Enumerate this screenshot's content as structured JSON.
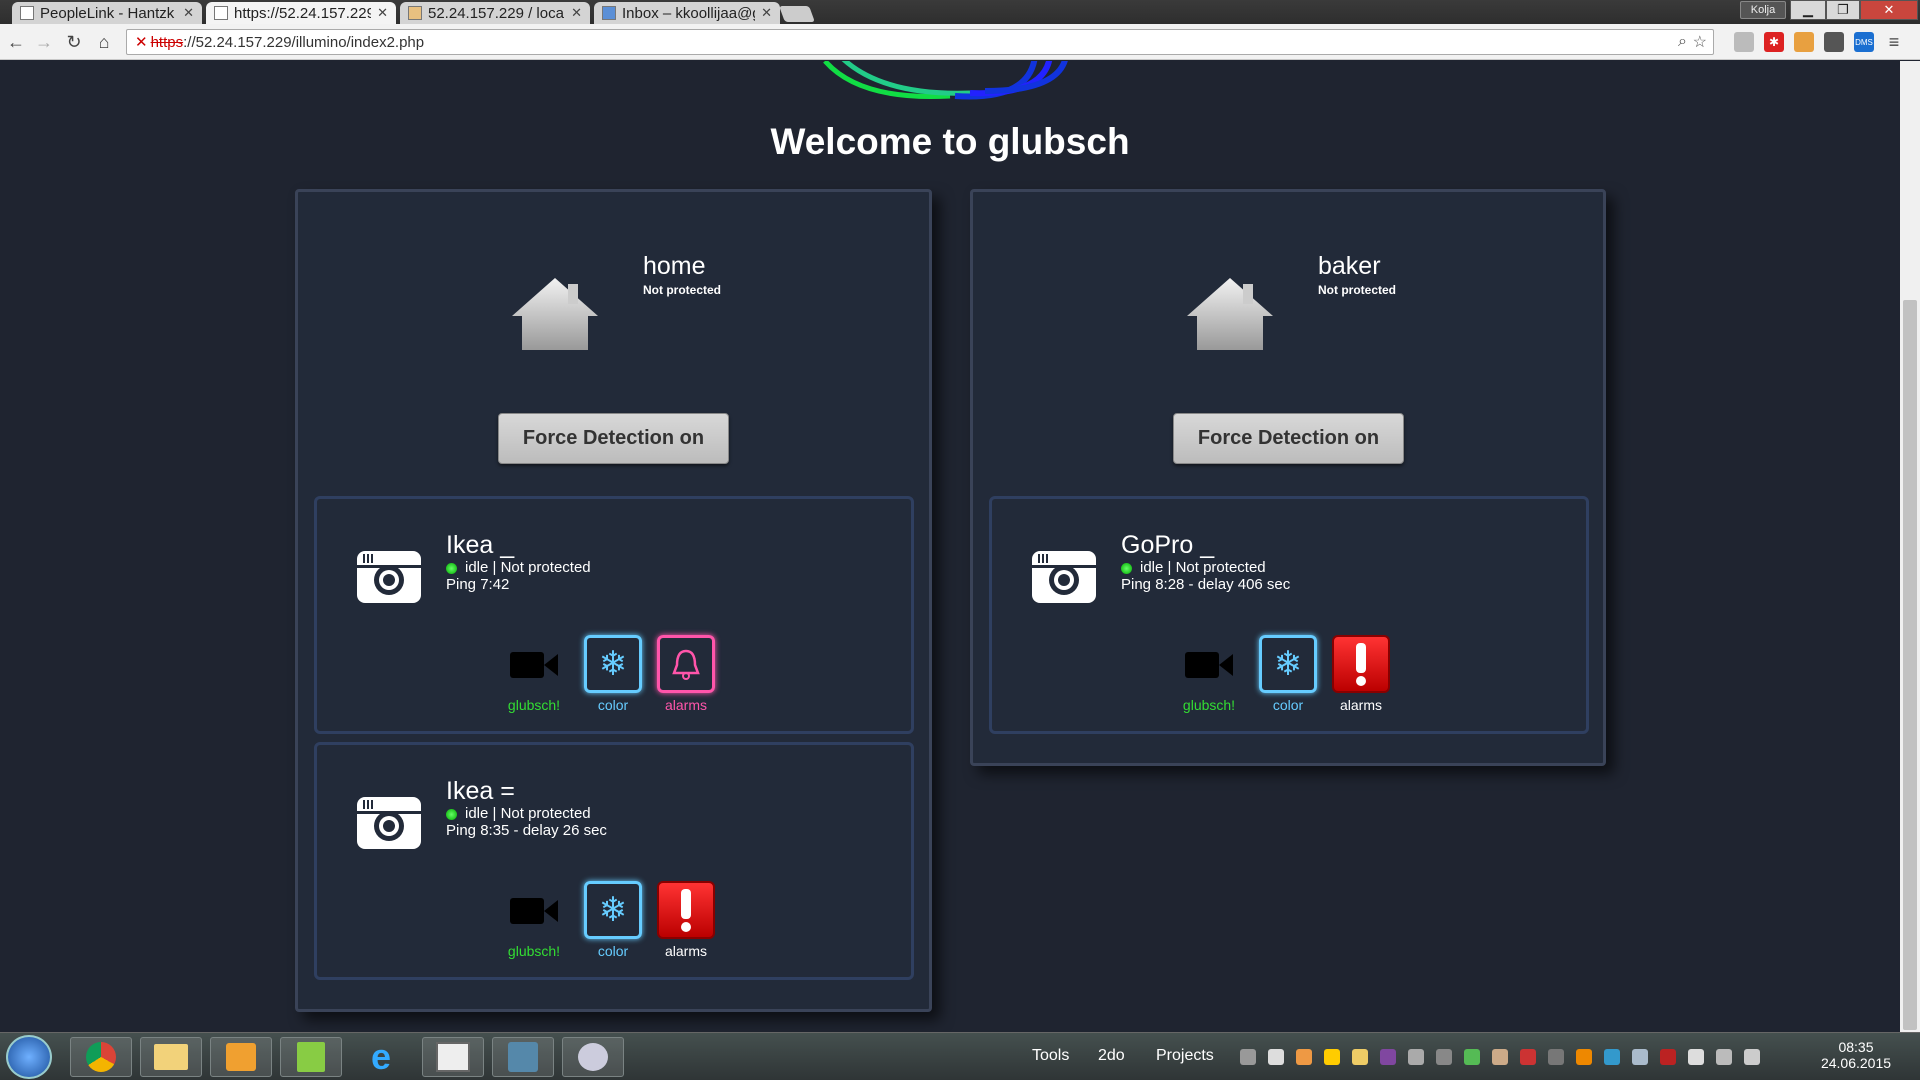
{
  "browser": {
    "tabs": [
      {
        "label": "PeopleLink - Hantzk"
      },
      {
        "label": "https://52.24.157.229"
      },
      {
        "label": "52.24.157.229 / local"
      },
      {
        "label": "Inbox – kkoollijaa@g"
      }
    ],
    "profile_name": "Kolja",
    "url_scheme": "https",
    "url_rest": "://52.24.157.229/illumino/index2.php"
  },
  "page": {
    "title": "Welcome to glubsch",
    "locations": [
      {
        "name": "home",
        "status": "Not protected",
        "force_button": "Force Detection on",
        "cameras": [
          {
            "name": "Ikea _",
            "state": "idle | Not protected",
            "ping": "Ping 7:42",
            "actions": [
              {
                "label": "glubsch!",
                "icon": "video-camera-icon"
              },
              {
                "label": "color",
                "icon": "snowflake-icon"
              },
              {
                "label": "alarms",
                "icon": "bell-icon"
              }
            ]
          },
          {
            "name": "Ikea =",
            "state": "idle | Not protected",
            "ping": "Ping 8:35 - delay 26 sec",
            "actions": [
              {
                "label": "glubsch!",
                "icon": "video-camera-icon"
              },
              {
                "label": "color",
                "icon": "snowflake-icon"
              },
              {
                "label": "alarms",
                "icon": "exclamation-icon"
              }
            ]
          }
        ]
      },
      {
        "name": "baker",
        "status": "Not protected",
        "force_button": "Force Detection on",
        "cameras": [
          {
            "name": "GoPro _",
            "state": "idle | Not protected",
            "ping": "Ping 8:28 - delay 406 sec",
            "actions": [
              {
                "label": "glubsch!",
                "icon": "video-camera-icon"
              },
              {
                "label": "color",
                "icon": "snowflake-icon"
              },
              {
                "label": "alarms",
                "icon": "exclamation-icon"
              }
            ]
          }
        ]
      }
    ]
  },
  "taskbar": {
    "toolbars": [
      "Tools",
      "2do",
      "Projects"
    ],
    "time": "08:35",
    "date": "24.06.2015"
  },
  "colors": {
    "page_bg": "#1f2430",
    "color_accent": "#66ccff",
    "alarm_accent": "#ff55aa",
    "glubsch_green": "#33dd33"
  }
}
